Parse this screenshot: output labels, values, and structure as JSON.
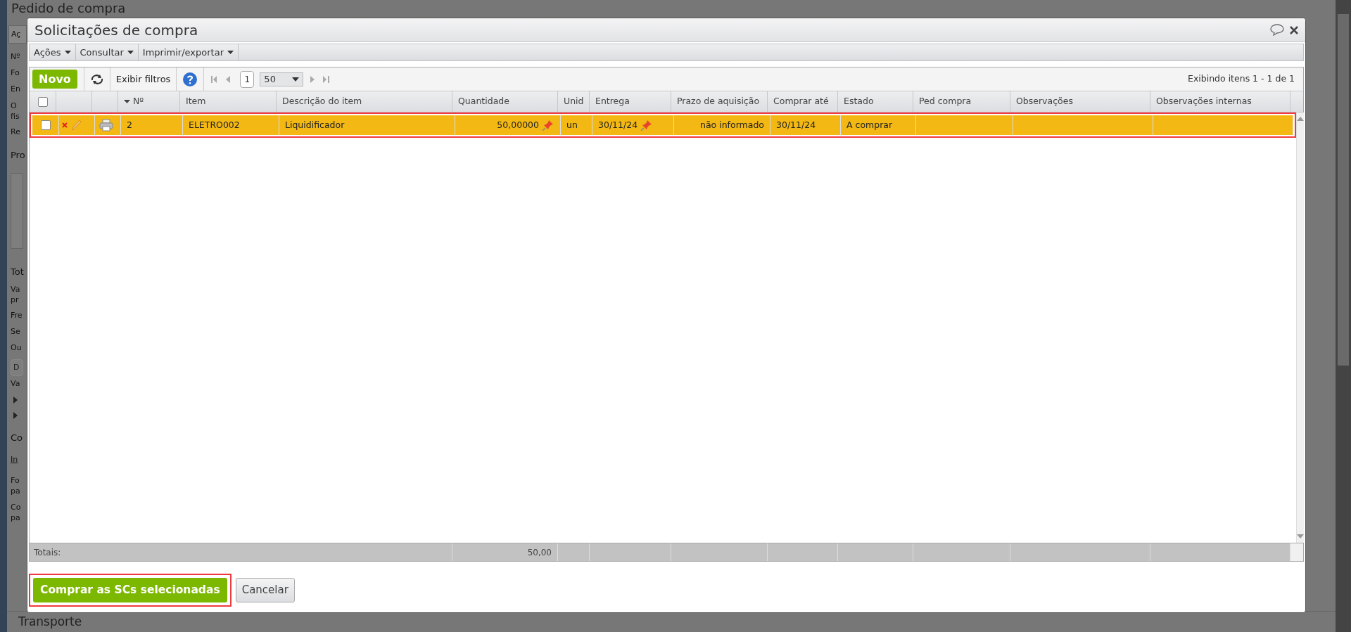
{
  "background_page": {
    "title": "Pedido de compra",
    "toolbar_item": "Aç",
    "labels": [
      {
        "kind": "label",
        "text": "Nº"
      },
      {
        "kind": "label",
        "text": "Fo"
      },
      {
        "kind": "label",
        "text": "En"
      },
      {
        "kind": "label2",
        "text": "O",
        "text2": "fis"
      },
      {
        "kind": "label",
        "text": "Re"
      },
      {
        "kind": "heading",
        "text": "Pro"
      },
      {
        "kind": "panel"
      },
      {
        "kind": "heading",
        "text": "Tot"
      },
      {
        "kind": "label2",
        "text": "Va",
        "text2": "pr"
      },
      {
        "kind": "label",
        "text": "Fre"
      },
      {
        "kind": "label",
        "text": "Se"
      },
      {
        "kind": "label",
        "text": "Ou"
      },
      {
        "kind": "field",
        "text": "D"
      },
      {
        "kind": "label",
        "text": "Va"
      },
      {
        "kind": "arrow"
      },
      {
        "kind": "arrow"
      },
      {
        "kind": "heading",
        "text": "Co"
      },
      {
        "kind": "link",
        "text": "In"
      },
      {
        "kind": "label2",
        "text": "Fo",
        "text2": "pa"
      },
      {
        "kind": "label2",
        "text": "Co",
        "text2": "pa"
      }
    ],
    "footer_heading": "Transporte"
  },
  "dialog": {
    "title": "Solicitações de compra",
    "menus": [
      "Ações",
      "Consultar",
      "Imprimir/exportar"
    ],
    "toolbar": {
      "new_button": "Novo",
      "filters_button": "Exibir filtros",
      "page": "1",
      "page_size": "50",
      "status": "Exibindo itens 1 - 1 de 1"
    },
    "table": {
      "columns": [
        {
          "kind": "check",
          "checked": false
        },
        {
          "kind": "actions"
        },
        {
          "kind": "print"
        },
        {
          "kind": "text",
          "label": "Nº",
          "sorted": true
        },
        {
          "kind": "text",
          "label": "Item"
        },
        {
          "kind": "text",
          "label": "Descrição do item"
        },
        {
          "kind": "text",
          "label": "Quantidade"
        },
        {
          "kind": "text",
          "label": "Unid"
        },
        {
          "kind": "text",
          "label": "Entrega"
        },
        {
          "kind": "text",
          "label": "Prazo de aquisição"
        },
        {
          "kind": "text",
          "label": "Comprar até"
        },
        {
          "kind": "text",
          "label": "Estado"
        },
        {
          "kind": "text",
          "label": "Ped compra"
        },
        {
          "kind": "text",
          "label": "Observações"
        },
        {
          "kind": "text",
          "label": "Observações internas"
        }
      ],
      "rows": [
        {
          "selected": true,
          "checked": false,
          "no": "2",
          "item": "ELETRO002",
          "description": "Liquidificador",
          "quantity": "50,00000",
          "unit": "un",
          "delivery": "30/11/24",
          "lead_time": "não informado",
          "buy_by": "30/11/24",
          "status": "A comprar"
        }
      ],
      "totals_label": "Totais:",
      "totals_quantity": "50,00"
    },
    "buttons": {
      "primary": "Comprar as SCs selecionadas",
      "secondary": "Cancelar"
    }
  }
}
